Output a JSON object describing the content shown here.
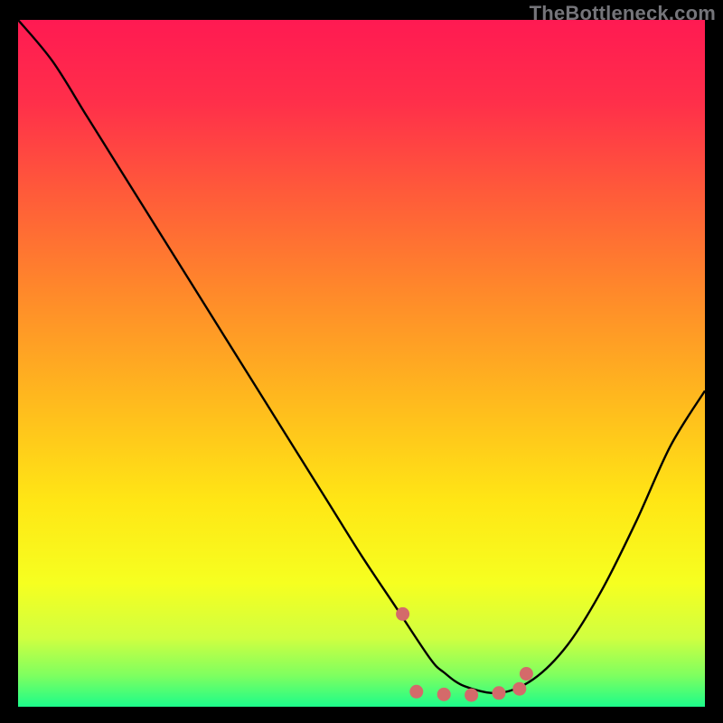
{
  "watermark": "TheBottleneck.com",
  "chart_data": {
    "type": "line",
    "title": "",
    "xlabel": "",
    "ylabel": "",
    "xlim": [
      0,
      100
    ],
    "ylim": [
      0,
      100
    ],
    "grid": false,
    "series": [
      {
        "name": "curve",
        "color": "#000000",
        "x": [
          0,
          5,
          10,
          15,
          20,
          25,
          30,
          35,
          40,
          45,
          50,
          55,
          60,
          62,
          65,
          70,
          75,
          80,
          85,
          90,
          95,
          100
        ],
        "y": [
          100,
          94,
          86,
          78,
          70,
          62,
          54,
          46,
          38,
          30,
          22,
          14.5,
          7,
          5,
          3,
          2,
          4,
          9,
          17,
          27,
          38,
          46
        ]
      },
      {
        "name": "highlight-dots",
        "color": "#d46a6a",
        "type": "scatter",
        "x": [
          56,
          58,
          62,
          66,
          70,
          73,
          74
        ],
        "y": [
          13.5,
          2.2,
          1.8,
          1.7,
          2.0,
          2.6,
          4.8
        ]
      }
    ],
    "background_gradient_stops": [
      {
        "offset": 0.0,
        "color": "#ff1a52"
      },
      {
        "offset": 0.12,
        "color": "#ff2f4a"
      },
      {
        "offset": 0.25,
        "color": "#ff5a3a"
      },
      {
        "offset": 0.4,
        "color": "#ff8a2a"
      },
      {
        "offset": 0.55,
        "color": "#ffb81e"
      },
      {
        "offset": 0.7,
        "color": "#ffe615"
      },
      {
        "offset": 0.82,
        "color": "#f6ff20"
      },
      {
        "offset": 0.9,
        "color": "#d0ff40"
      },
      {
        "offset": 0.955,
        "color": "#7dff60"
      },
      {
        "offset": 1.0,
        "color": "#1cfc8a"
      }
    ]
  }
}
